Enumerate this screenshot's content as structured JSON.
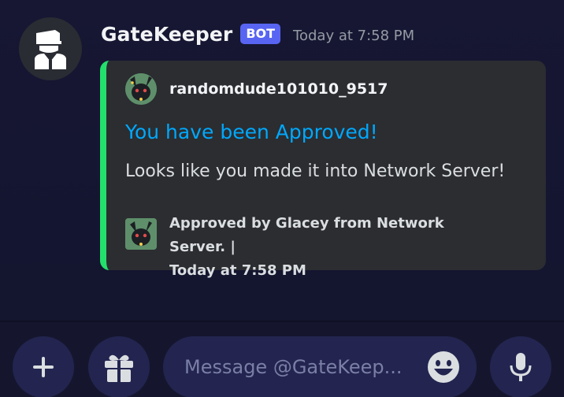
{
  "message": {
    "author": "GateKeeper",
    "badge": "BOT",
    "timestamp": "Today at 7:58 PM",
    "avatar_icon": "security-guard-icon"
  },
  "embed": {
    "accent_color": "#23e06c",
    "author_name": "randomdude101010_9517",
    "title": "You have been Approved!",
    "title_color": "#00a8fc",
    "description": "Looks like you made it into Network Server!",
    "footer_line1": "Approved by Glacey from Network Server. |",
    "footer_line2": "Today at 7:58 PM"
  },
  "composer": {
    "placeholder": "Message @GateKeep...",
    "add_icon": "plus-icon",
    "gift_icon": "gift-icon",
    "emoji_icon": "emoji-icon",
    "mic_icon": "microphone-icon"
  }
}
